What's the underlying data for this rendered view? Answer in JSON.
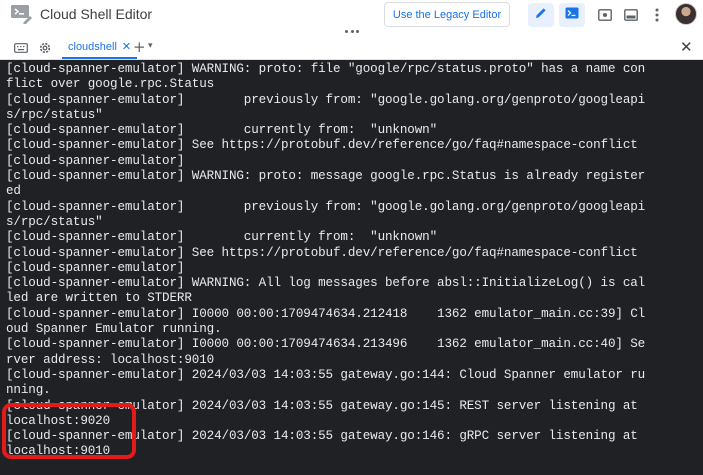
{
  "app": {
    "title": "Cloud Shell Editor",
    "icon": "cloud-shell-editor-icon"
  },
  "toolbar": {
    "legacy_button_label": "Use the Legacy Editor",
    "icons": [
      "pencil-icon",
      "terminal-icon",
      "preview-icon",
      "layout-icon",
      "more-vert-icon"
    ]
  },
  "tabs": {
    "items": [
      {
        "label": "cloudshell",
        "close": "✕"
      }
    ],
    "add": "+",
    "menu": "▾",
    "panel_close": "✕"
  },
  "terminal": {
    "lines": [
      "[cloud-spanner-emulator] WARNING: proto: file \"google/rpc/status.proto\" has a name con",
      "flict over google.rpc.Status",
      "[cloud-spanner-emulator]        previously from: \"google.golang.org/genproto/googleapi",
      "s/rpc/status\"",
      "[cloud-spanner-emulator]        currently from:  \"unknown\"",
      "[cloud-spanner-emulator] See https://protobuf.dev/reference/go/faq#namespace-conflict",
      "[cloud-spanner-emulator]",
      "[cloud-spanner-emulator] WARNING: proto: message google.rpc.Status is already register",
      "ed",
      "[cloud-spanner-emulator]        previously from: \"google.golang.org/genproto/googleapi",
      "s/rpc/status\"",
      "[cloud-spanner-emulator]        currently from:  \"unknown\"",
      "[cloud-spanner-emulator] See https://protobuf.dev/reference/go/faq#namespace-conflict",
      "[cloud-spanner-emulator]",
      "[cloud-spanner-emulator] WARNING: All log messages before absl::InitializeLog() is cal",
      "led are written to STDERR",
      "[cloud-spanner-emulator] I0000 00:00:1709474634.212418    1362 emulator_main.cc:39] Cl",
      "oud Spanner Emulator running.",
      "[cloud-spanner-emulator] I0000 00:00:1709474634.213496    1362 emulator_main.cc:40] Se",
      "rver address: localhost:9010",
      "[cloud-spanner-emulator] 2024/03/03 14:03:55 gateway.go:144: Cloud Spanner emulator ru",
      "nning.",
      "[cloud-spanner-emulator] 2024/03/03 14:03:55 gateway.go:145: REST server listening at",
      "localhost:9020",
      "[cloud-spanner-emulator] 2024/03/03 14:03:55 gateway.go:146: gRPC server listening at",
      "localhost:9010"
    ]
  },
  "colors": {
    "accent": "#1a73e8",
    "terminal_bg": "#202124",
    "terminal_fg": "#e8eaed",
    "highlight": "#e11a1a"
  }
}
